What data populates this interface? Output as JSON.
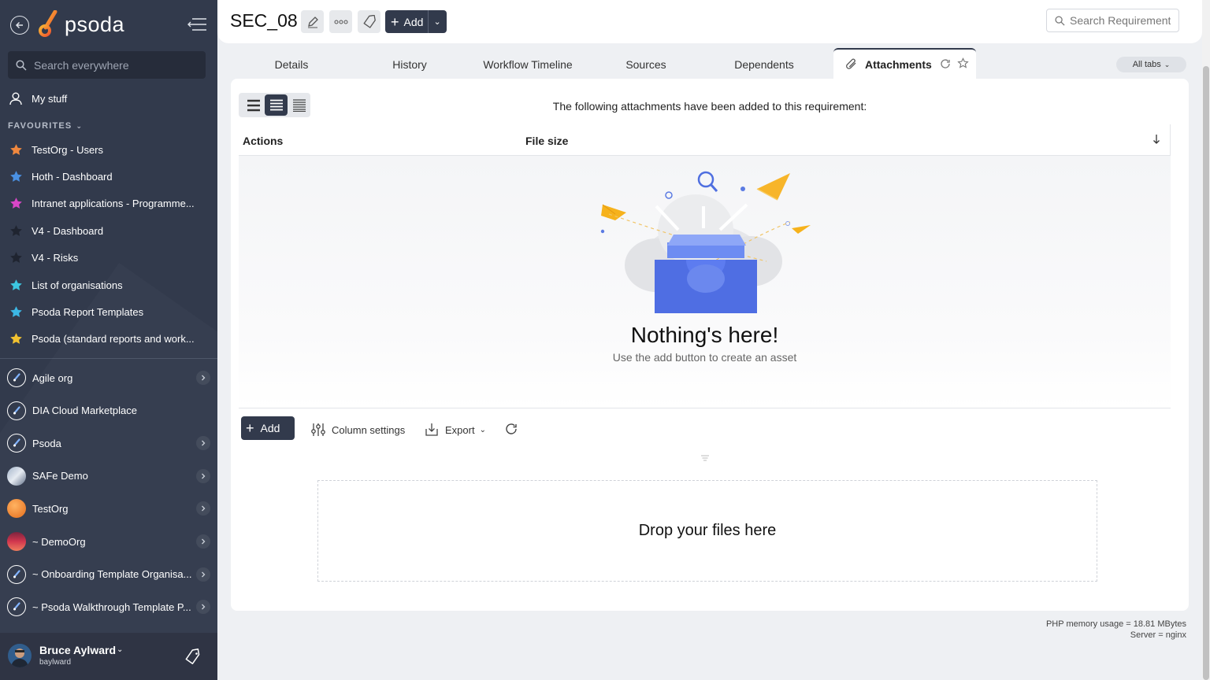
{
  "sidebar": {
    "logo_text": "psoda",
    "search_placeholder": "Search everywhere",
    "my_stuff": "My stuff",
    "favourites_header": "FAVOURITES",
    "favourites": [
      {
        "label": "TestOrg - Users",
        "color": "#f0883e"
      },
      {
        "label": "Hoth - Dashboard",
        "color": "#4a90e2"
      },
      {
        "label": "Intranet applications - Programme...",
        "color": "#d946c8"
      },
      {
        "label": "V4 - Dashboard",
        "color": "#1f2430"
      },
      {
        "label": "V4 - Risks",
        "color": "#1f2430"
      },
      {
        "label": "List of organisations",
        "color": "#3cc6e0"
      },
      {
        "label": "Psoda Report Templates",
        "color": "#3cb8e6"
      },
      {
        "label": "Psoda (standard reports and work...",
        "color": "#f2c230"
      }
    ],
    "orgs": [
      {
        "label": "Agile org",
        "avatar": "psoda-icon"
      },
      {
        "label": "DIA Cloud Marketplace",
        "avatar": "psoda-icon"
      },
      {
        "label": "Psoda",
        "avatar": "psoda-icon"
      },
      {
        "label": "SAFe Demo",
        "avatar": "safe-icon"
      },
      {
        "label": "TestOrg",
        "avatar": "orange-circle-icon"
      },
      {
        "label": "~ DemoOrg",
        "avatar": "sunset-icon"
      },
      {
        "label": "~ Onboarding Template Organisa...",
        "avatar": "psoda-icon"
      },
      {
        "label": "~ Psoda Walkthrough Template P...",
        "avatar": "psoda-icon"
      }
    ],
    "user": {
      "name": "Bruce Aylward",
      "handle": "baylward"
    }
  },
  "header": {
    "title": "SEC_08",
    "add_label": "Add",
    "search_placeholder": "Search Requirement"
  },
  "tabs": {
    "items": [
      "Details",
      "History",
      "Workflow Timeline",
      "Sources",
      "Dependents"
    ],
    "active": "Attachments",
    "all_tabs": "All tabs"
  },
  "main": {
    "message": "The following attachments have been added to this requirement:",
    "columns": [
      "Actions",
      "File size"
    ],
    "empty_title": "Nothing's here!",
    "empty_subtitle": "Use the add button to create an asset",
    "toolbar": {
      "add": "Add",
      "column_settings": "Column settings",
      "export": "Export"
    },
    "drop_zone": "Drop your files here"
  },
  "footer": {
    "memory": "PHP memory usage = 18.81 MBytes",
    "server": "Server = nginx"
  },
  "colors": {
    "sidebar_bg": "#323a4c",
    "accent_dark": "#323a4c",
    "brand_orange": "#f0883e"
  }
}
